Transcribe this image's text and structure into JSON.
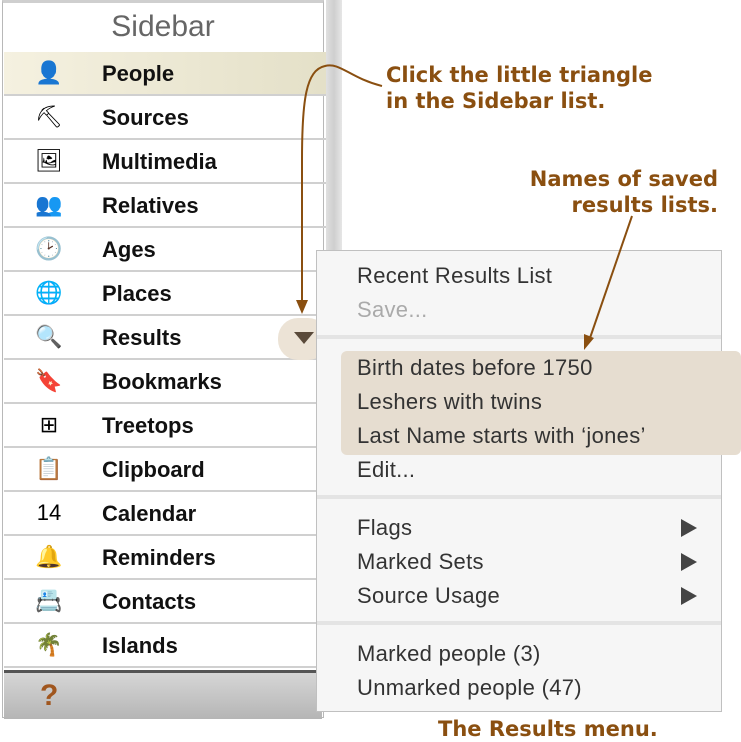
{
  "sidebar": {
    "title": "Sidebar",
    "items": [
      {
        "label": "People",
        "icon": "person-icon",
        "glyph": "👤",
        "active": true
      },
      {
        "label": "Sources",
        "icon": "shovel-icon",
        "glyph": "⛏"
      },
      {
        "label": "Multimedia",
        "icon": "photo-icon",
        "glyph": "🖼"
      },
      {
        "label": "Relatives",
        "icon": "relatives-icon",
        "glyph": "👥"
      },
      {
        "label": "Ages",
        "icon": "clock-icon",
        "glyph": "🕑"
      },
      {
        "label": "Places",
        "icon": "globe-icon",
        "glyph": "🌐"
      },
      {
        "label": "Results",
        "icon": "magnifier-icon",
        "glyph": "🔍"
      },
      {
        "label": "Bookmarks",
        "icon": "bookmark-icon",
        "glyph": "🔖"
      },
      {
        "label": "Treetops",
        "icon": "tree-chart-icon",
        "glyph": "⊞"
      },
      {
        "label": "Clipboard",
        "icon": "clipboard-icon",
        "glyph": "📋"
      },
      {
        "label": "Calendar",
        "icon": "calendar-icon",
        "glyph": "14"
      },
      {
        "label": "Reminders",
        "icon": "bell-icon",
        "glyph": "🔔"
      },
      {
        "label": "Contacts",
        "icon": "contact-card-icon",
        "glyph": "📇"
      },
      {
        "label": "Islands",
        "icon": "palm-tree-icon",
        "glyph": "🌴"
      }
    ],
    "footer_icon": "?"
  },
  "menu": {
    "top": [
      "Recent Results List",
      "Save..."
    ],
    "saved": [
      "Birth dates before 1750",
      "Leshers with twins",
      "Last Name starts with ‘jones’"
    ],
    "edit": "Edit...",
    "submenus": [
      "Flags",
      "Marked Sets",
      "Source Usage"
    ],
    "bottom": [
      "Marked people (3)",
      "Unmarked people (47)"
    ]
  },
  "notes": {
    "triangle_line1": "Click the little triangle",
    "triangle_line2": "in the Sidebar list.",
    "saved_line1": "Names of saved",
    "saved_line2": "results lists.",
    "caption": "The Results menu."
  }
}
